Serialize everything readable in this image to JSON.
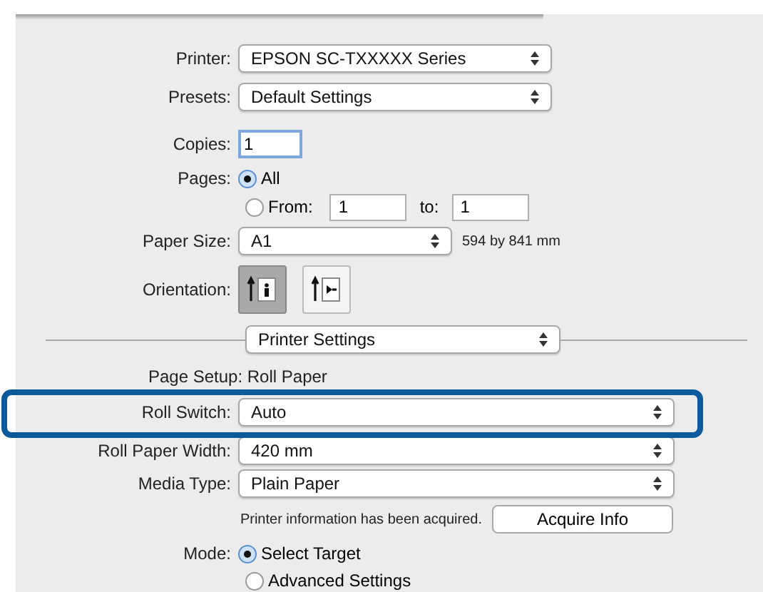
{
  "printer": {
    "label": "Printer:",
    "value": "EPSON SC-TXXXXX Series"
  },
  "presets": {
    "label": "Presets:",
    "value": "Default Settings"
  },
  "copies": {
    "label": "Copies:",
    "value": "1"
  },
  "pages": {
    "label": "Pages:",
    "options": [
      {
        "label": "All",
        "selected": true
      },
      {
        "label": "From:",
        "selected": false
      }
    ],
    "from": "1",
    "to_label": "to:",
    "to": "1"
  },
  "paper_size": {
    "label": "Paper Size:",
    "value": "A1",
    "dimensions": "594 by 841 mm"
  },
  "orientation": {
    "label": "Orientation:",
    "options": [
      {
        "kind": "portrait",
        "selected": true
      },
      {
        "kind": "landscape",
        "selected": false
      }
    ]
  },
  "section": {
    "value": "Printer Settings"
  },
  "page_setup": "Page Setup: Roll Paper",
  "roll_switch": {
    "label": "Roll Switch:",
    "value": "Auto",
    "highlighted": true
  },
  "roll_paper_width": {
    "label": "Roll Paper Width:",
    "value": "420 mm"
  },
  "media_type": {
    "label": "Media Type:",
    "value": "Plain Paper"
  },
  "info": {
    "text": "Printer information has been acquired.",
    "button": "Acquire Info"
  },
  "mode": {
    "label": "Mode:",
    "options": [
      {
        "label": "Select Target",
        "selected": true
      },
      {
        "label": "Advanced Settings",
        "selected": false
      }
    ]
  }
}
